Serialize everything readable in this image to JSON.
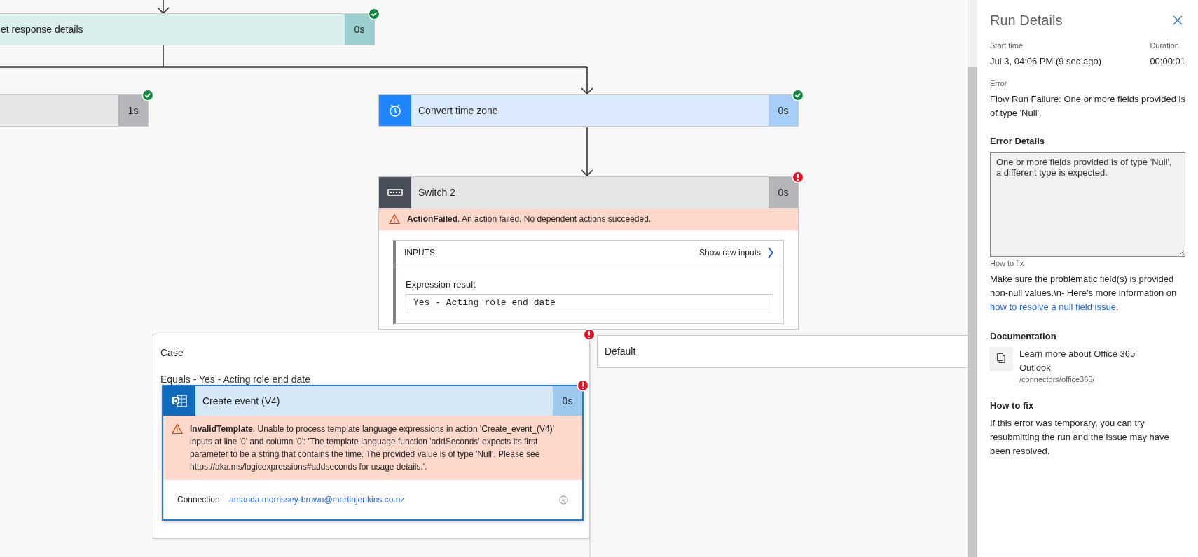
{
  "canvas": {
    "nodes": [
      {
        "kind": "variable",
        "title": "et response details",
        "duration": "0s",
        "succeeded": true
      },
      {
        "kind": "control",
        "duration": "1s",
        "succeeded": true
      },
      {
        "kind": "datetime",
        "title": "Convert time zone",
        "duration": "0s",
        "succeeded": true
      },
      {
        "kind": "switch",
        "title": "Switch 2",
        "duration": "0s",
        "succeeded": false,
        "error": "**ActionFailed**. An action failed. No dependent actions succeeded.",
        "inputs": {
          "heading": "INPUTS",
          "raw_link": "Show raw inputs",
          "field_label": "Expression result",
          "field_value": "Yes - Acting role end date"
        }
      }
    ],
    "branches": [
      {
        "title": "Case",
        "succeeded": false,
        "condition": "Equals - Yes - Acting role end date",
        "action": {
          "kind": "outlook",
          "title": "Create event (V4)",
          "duration": "0s",
          "succeeded": false,
          "error": "**InvalidTemplate**. Unable to process template language expressions in action 'Create_event_(V4)' inputs at line '0' and column '0': 'The template language function 'addSeconds' expects its first parameter to be a string that contains the time. The provided value is of type 'Null'. Please see https://aka.ms/logicexpressions#addseconds for usage details.'.",
          "connection": {
            "label": "Connection:",
            "account": "amanda.morrissey-brown@martinjenkins.co.nz",
            "verified": true
          }
        }
      },
      {
        "title": "Default"
      }
    ]
  },
  "run_details": {
    "title": "Run Details",
    "start_time": {
      "label": "Start time",
      "value": "Jul 3, 04:06 PM (9 sec ago)"
    },
    "duration": {
      "label": "Duration",
      "value": "00:00:01"
    },
    "error": {
      "label": "Error",
      "text": "Flow Run Failure: One or more fields provided is of type 'Null'."
    },
    "error_details": {
      "heading": "Error Details",
      "value": "One or more fields provided is of type 'Null', a different type is expected."
    },
    "how_to_fix": {
      "label": "How to fix",
      "text_before": "Make sure the problematic field(s) is provided non-null values.\\n- Here's more information on ",
      "link": "how to resolve a null field issue",
      "text_after": "."
    },
    "documentation": {
      "heading": "Documentation",
      "title": "Learn more about Office 365 Outlook",
      "path": "/connectors/office365/"
    },
    "how_to_fix_section": {
      "heading": "How to fix",
      "text": "If this error was temporary, you can try resubmitting the run and the issue may have been resolved."
    }
  }
}
